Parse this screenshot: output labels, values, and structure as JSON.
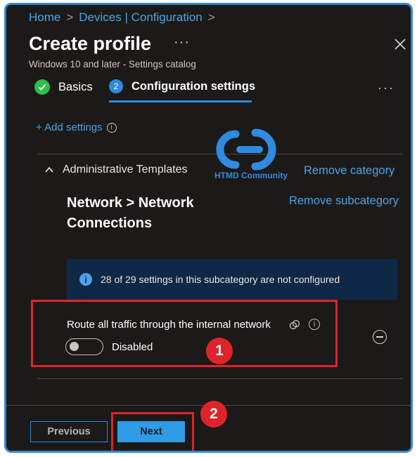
{
  "breadcrumb": {
    "home": "Home",
    "sep": ">",
    "devices": "Devices | Configuration"
  },
  "header": {
    "title": "Create profile",
    "more": "···",
    "subtitle": "Windows 10 and later - Settings catalog"
  },
  "steps": [
    {
      "label": "Basics",
      "state": "complete"
    },
    {
      "number": "2",
      "label": "Configuration settings",
      "state": "current"
    }
  ],
  "tabs_more": "···",
  "add_settings": "+ Add settings",
  "watermark": {
    "text": "HTMD Community"
  },
  "category": {
    "label": "Administrative Templates",
    "remove": "Remove category"
  },
  "subcategory": {
    "title": "Network > Network Connections",
    "remove": "Remove subcategory"
  },
  "info_banner": {
    "text": "28 of 29 settings in this subcategory are not configured"
  },
  "setting": {
    "name": "Route all traffic through the internal network",
    "toggle_state": "Disabled"
  },
  "annotations": {
    "badge1": "1",
    "badge2": "2"
  },
  "footer": {
    "previous": "Previous",
    "next": "Next"
  },
  "colors": {
    "accent": "#2f8ae0",
    "highlight": "#e0232a",
    "background": "#1b1a19",
    "success": "#2bbf4b"
  }
}
